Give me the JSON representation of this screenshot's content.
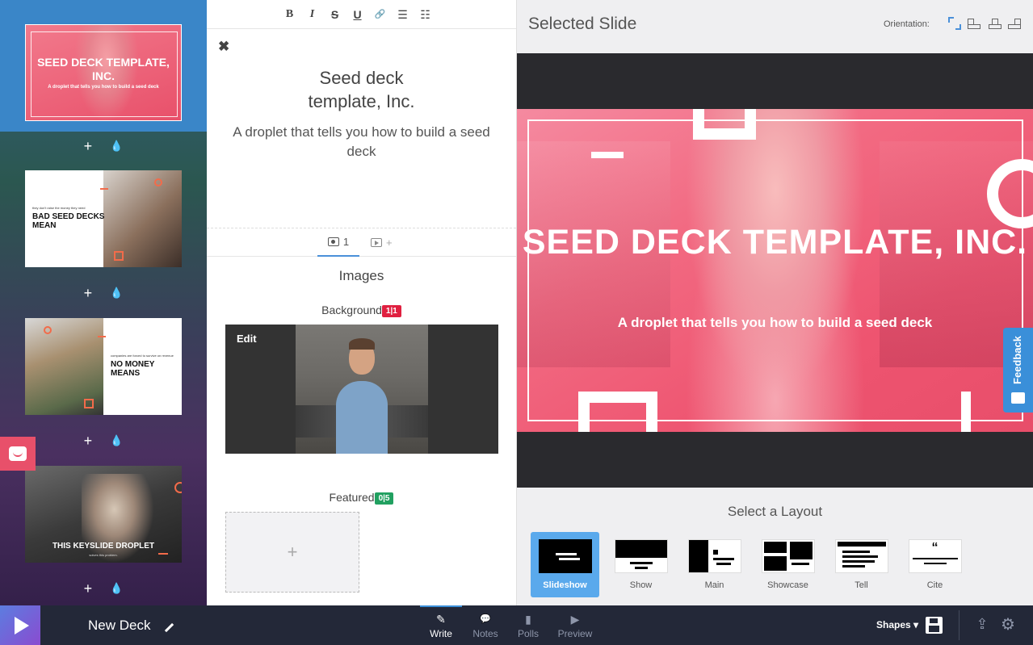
{
  "thumbnails": {
    "slide1": {
      "title": "SEED DECK TEMPLATE, INC.",
      "subtitle": "A droplet that tells you how to build a seed deck"
    },
    "slide2": {
      "kicker": "they don't raise the money they need",
      "title": "BAD SEED DECKS MEAN"
    },
    "slide3": {
      "kicker": "companies are forced to survive on revenue",
      "title": "NO MONEY MEANS"
    },
    "slide4": {
      "title": "THIS KEYSLIDE DROPLET",
      "subtitle": "solves this problem."
    },
    "add_label": "+",
    "droplet_label": "💧"
  },
  "toolbar": {
    "bold": "B",
    "italic": "I",
    "strike": "S",
    "underline": "U",
    "link": "🔗",
    "ordered": "☰",
    "bullet": "☷"
  },
  "editor": {
    "close": "✖",
    "title": "Seed deck\ntemplate, Inc.",
    "subtitle": "A droplet that tells you how to build a seed deck",
    "tab_images_count": "1",
    "tab_video_add": "+",
    "images_heading": "Images",
    "background_label": "Background",
    "background_badge": "1|1",
    "edit_label": "Edit",
    "featured_label": "Featured",
    "featured_badge": "0|5",
    "add_featured": "+"
  },
  "preview": {
    "heading": "Selected Slide",
    "orientation_label": "Orientation:",
    "slide_title": "SEED DECK TEMPLATE, INC.",
    "slide_subtitle": "A droplet that tells you how to build a seed deck",
    "feedback_label": "Feedback"
  },
  "layouts": {
    "heading": "Select a Layout",
    "items": [
      {
        "label": "Slideshow",
        "active": true
      },
      {
        "label": "Show"
      },
      {
        "label": "Main"
      },
      {
        "label": "Showcase"
      },
      {
        "label": "Tell"
      },
      {
        "label": "Cite",
        "icon_text": "“"
      }
    ]
  },
  "bottom": {
    "deck_name": "New Deck",
    "nav": [
      {
        "label": "Write",
        "icon": "✎",
        "active": true
      },
      {
        "label": "Notes",
        "icon": "💬"
      },
      {
        "label": "Polls",
        "icon": "▮"
      },
      {
        "label": "Preview",
        "icon": "▶"
      }
    ],
    "shapes_label": "Shapes ▾",
    "share_icon": "⇪",
    "settings_icon": "⚙"
  },
  "colors": {
    "accent": "#3a8fd9",
    "slide_pink": "#ee5470",
    "badge_red": "#e02040",
    "badge_green": "#21a060",
    "bottom_bar": "#232838"
  }
}
